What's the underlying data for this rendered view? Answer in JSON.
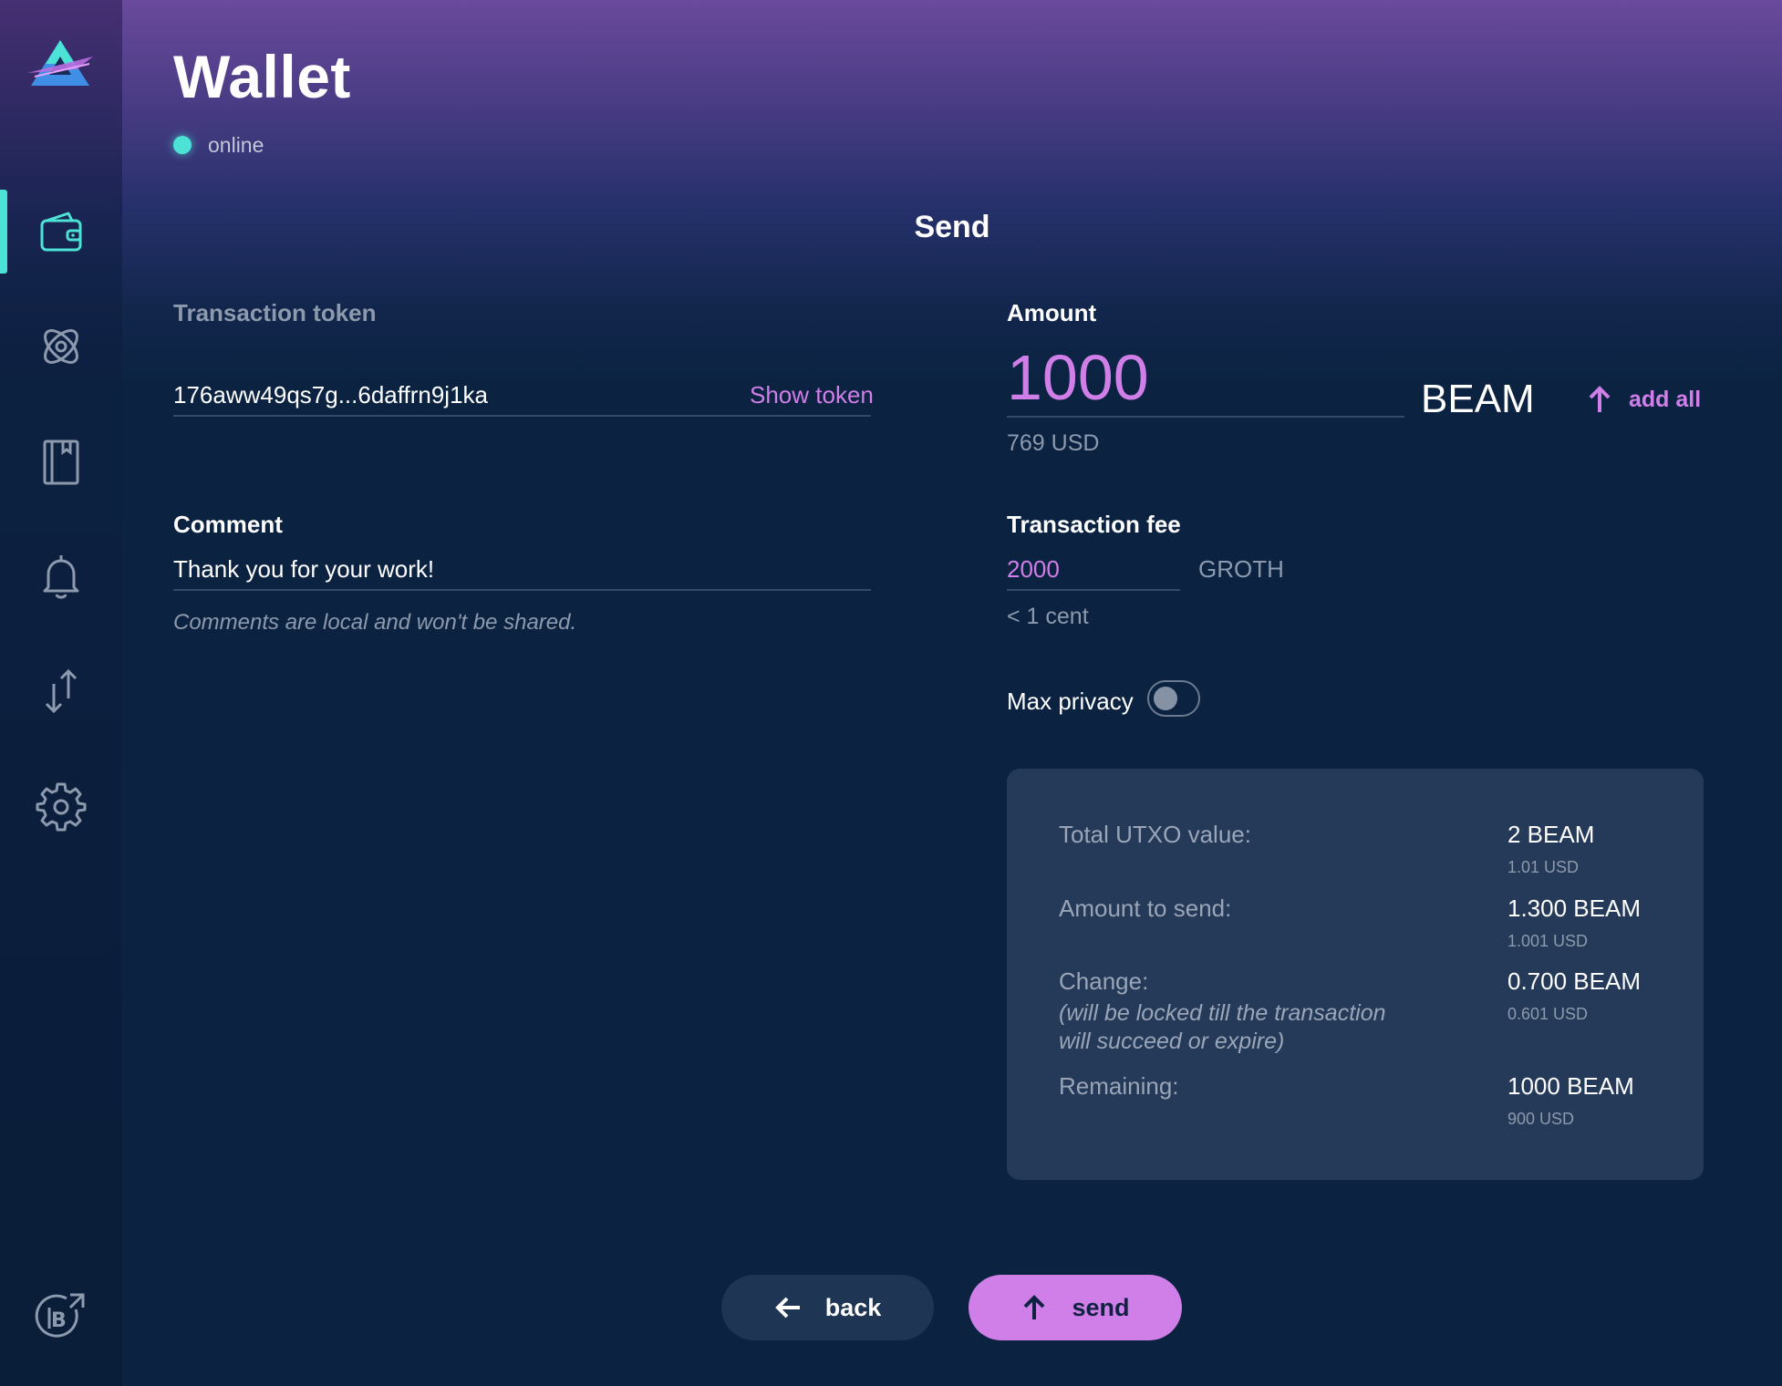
{
  "app": {
    "title": "Wallet",
    "status": "online",
    "colors": {
      "accent": "#d07fe8",
      "online": "#4ce3d6",
      "background": "#0b2341"
    }
  },
  "sidebar": {
    "logo": "beam-logo",
    "items": [
      {
        "icon": "wallet-icon",
        "active": true
      },
      {
        "icon": "atom-icon",
        "active": false
      },
      {
        "icon": "address-book-icon",
        "active": false
      },
      {
        "icon": "bell-icon",
        "active": false
      },
      {
        "icon": "swap-icon",
        "active": false
      },
      {
        "icon": "gear-icon",
        "active": false
      }
    ],
    "bottom_icon": "beam-external-link-icon"
  },
  "send": {
    "heading": "Send",
    "token_label": "Transaction token",
    "token_value": "176aww49qs7g...6daffrn9j1ka",
    "show_token": "Show token",
    "comment_label": "Comment",
    "comment_value": "Thank you for your work!",
    "comment_hint": "Comments are local and won't be shared.",
    "amount_label": "Amount",
    "amount_value": "1000",
    "amount_unit": "BEAM",
    "amount_usd": "769 USD",
    "add_all": "add all",
    "fee_label": "Transaction fee",
    "fee_value": "2000",
    "fee_unit": "GROTH",
    "fee_cent": "< 1 cent",
    "max_privacy_label": "Max privacy",
    "max_privacy_on": false
  },
  "summary": {
    "total_label": "Total UTXO value:",
    "total_value": "2 BEAM",
    "total_usd": "1.01 USD",
    "send_label": "Amount to send:",
    "send_value": "1.300 BEAM",
    "send_usd": "1.001 USD",
    "change_label": "Change:",
    "change_note_1": "(will be locked till the transaction",
    "change_note_2": "will succeed or expire)",
    "change_value": "0.700 BEAM",
    "change_usd": "0.601 USD",
    "remaining_label": "Remaining:",
    "remaining_value": "1000 BEAM",
    "remaining_usd": "900 USD"
  },
  "buttons": {
    "back": "back",
    "send": "send"
  }
}
